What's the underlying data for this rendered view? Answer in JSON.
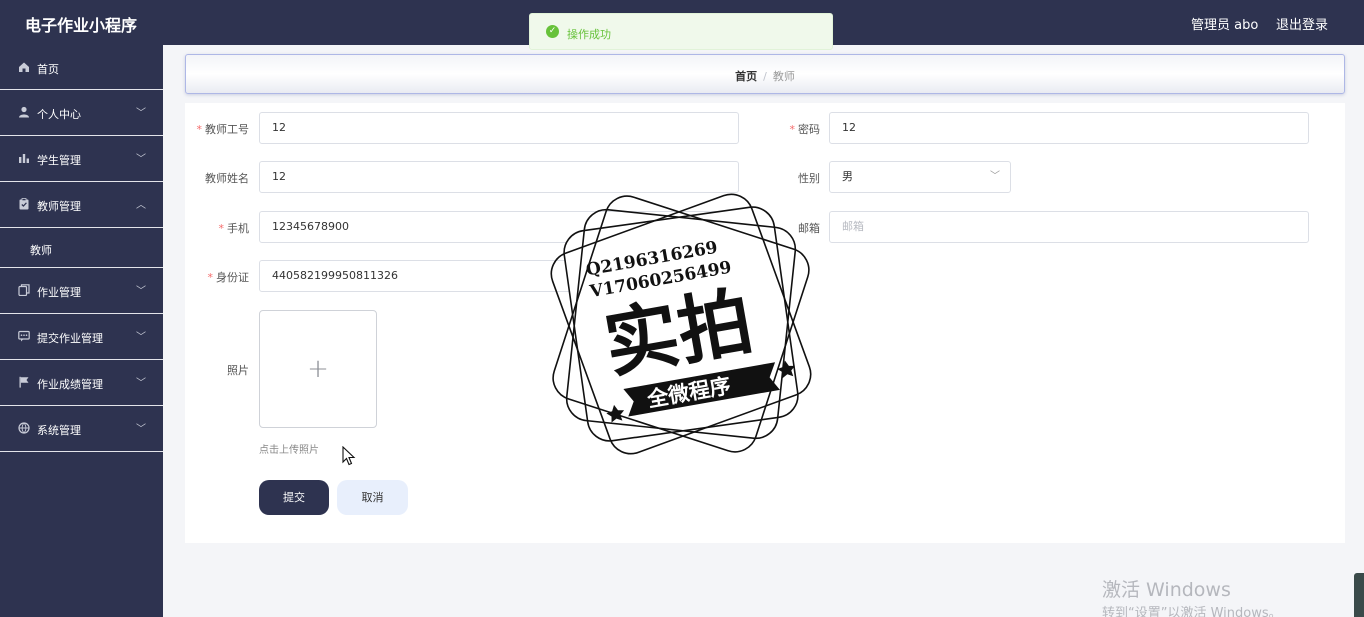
{
  "header": {
    "app_title": "电子作业小程序",
    "user_label": "管理员 abo",
    "logout_label": "退出登录"
  },
  "sidebar": {
    "items": [
      {
        "label": "首页",
        "icon": "home-icon"
      },
      {
        "label": "个人中心",
        "icon": "user-icon"
      },
      {
        "label": "学生管理",
        "icon": "bar-chart-icon"
      },
      {
        "label": "教师管理",
        "icon": "clipboard-icon",
        "expanded": true,
        "children": [
          {
            "label": "教师"
          }
        ]
      },
      {
        "label": "作业管理",
        "icon": "copy-icon"
      },
      {
        "label": "提交作业管理",
        "icon": "message-icon"
      },
      {
        "label": "作业成绩管理",
        "icon": "flag-icon"
      },
      {
        "label": "系统管理",
        "icon": "globe-icon"
      }
    ]
  },
  "breadcrumb": {
    "home": "首页",
    "separator": "/",
    "current": "教师"
  },
  "toast": {
    "message": "操作成功",
    "type": "success",
    "color": "#67c23a"
  },
  "form": {
    "teacher_id": {
      "label": "教师工号",
      "value": "12",
      "required": true
    },
    "password": {
      "label": "密码",
      "value": "12",
      "required": true
    },
    "teacher_name": {
      "label": "教师姓名",
      "value": "12"
    },
    "gender": {
      "label": "性别",
      "value": "男"
    },
    "phone": {
      "label": "手机",
      "value": "12345678900",
      "required": true
    },
    "email": {
      "label": "邮箱",
      "placeholder": "邮箱"
    },
    "id_card": {
      "label": "身份证",
      "value": "440582199950811326",
      "required": true
    },
    "photo": {
      "label": "照片",
      "upload_tip": "点击上传照片"
    },
    "submit_label": "提交",
    "cancel_label": "取消"
  },
  "watermark": {
    "line1": "Q2196316269",
    "line2": "V17060256499",
    "big_text": "实拍",
    "banner": "全微程序"
  },
  "windows": {
    "line1": "激活 Windows",
    "line2": "转到“设置”以激活 Windows。"
  },
  "colors": {
    "sidebar_bg": "#2e3350",
    "header_bg": "#2e3350",
    "primary_button": "#2e3350",
    "required_star": "#f56c6c",
    "success": "#67c23a"
  }
}
